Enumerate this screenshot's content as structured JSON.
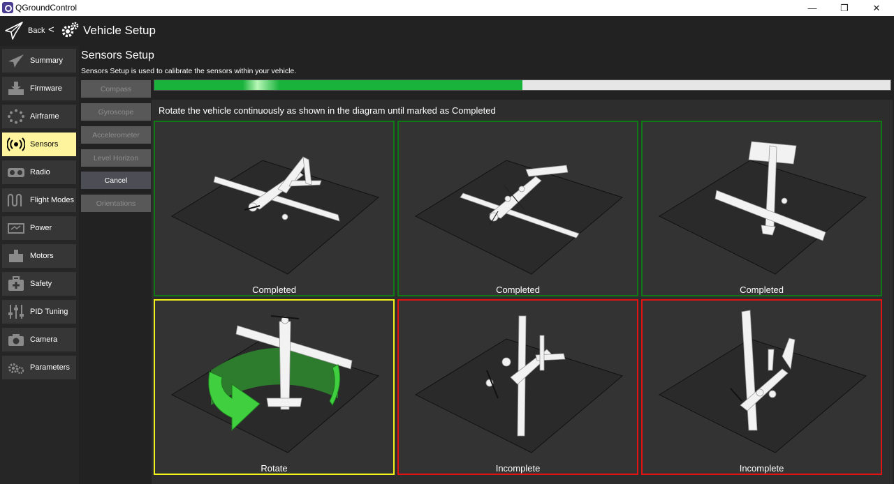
{
  "window": {
    "title": "QGroundControl",
    "controls": {
      "minimize": "—",
      "maximize": "❐",
      "close": "✕"
    }
  },
  "toolbar": {
    "back_label": "Back",
    "separator": "<",
    "title": "Vehicle Setup"
  },
  "sidebar": {
    "items": [
      {
        "label": "Summary",
        "icon": "paper-plane-icon"
      },
      {
        "label": "Firmware",
        "icon": "download-tray-icon"
      },
      {
        "label": "Airframe",
        "icon": "dots-circle-icon"
      },
      {
        "label": "Sensors",
        "icon": "radio-waves-icon",
        "active": true
      },
      {
        "label": "Radio",
        "icon": "radio-transmitter-icon"
      },
      {
        "label": "Flight Modes",
        "icon": "waves-icon"
      },
      {
        "label": "Power",
        "icon": "battery-icon"
      },
      {
        "label": "Motors",
        "icon": "motor-icon"
      },
      {
        "label": "Safety",
        "icon": "first-aid-kit-icon"
      },
      {
        "label": "PID Tuning",
        "icon": "sliders-icon"
      },
      {
        "label": "Camera",
        "icon": "camera-icon"
      },
      {
        "label": "Parameters",
        "icon": "gears-icon"
      }
    ]
  },
  "sensors": {
    "title": "Sensors Setup",
    "description": "Sensors Setup is used to calibrate the sensors within your vehicle.",
    "buttons": [
      {
        "label": "Compass",
        "enabled": false
      },
      {
        "label": "Gyroscope",
        "enabled": false
      },
      {
        "label": "Accelerometer",
        "enabled": false
      },
      {
        "label": "Level Horizon",
        "enabled": false
      },
      {
        "label": "Cancel",
        "enabled": true
      },
      {
        "label": "Orientations",
        "enabled": false
      }
    ],
    "progress": 0.5,
    "instructions": "Rotate the vehicle continuously as shown in the diagram until marked as Completed",
    "tiles": [
      {
        "status": "Completed",
        "orientation": "level",
        "color": "#0f7a15"
      },
      {
        "status": "Completed",
        "orientation": "inverted",
        "color": "#0f7a15"
      },
      {
        "status": "Completed",
        "orientation": "nose-down",
        "color": "#0f7a15"
      },
      {
        "status": "Rotate",
        "orientation": "nose-up",
        "color": "#f3f31a"
      },
      {
        "status": "Incomplete",
        "orientation": "left-side",
        "color": "#e21313"
      },
      {
        "status": "Incomplete",
        "orientation": "right-side",
        "color": "#e21313"
      }
    ]
  }
}
